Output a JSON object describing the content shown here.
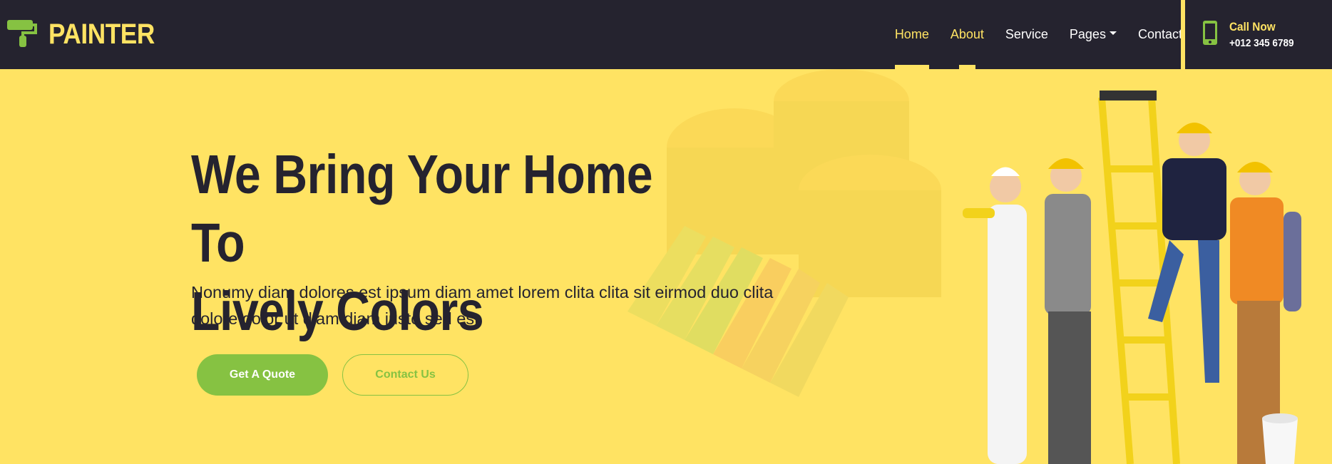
{
  "brand": {
    "name": "PAINTER",
    "logo_icon": "paint-roller-icon",
    "logo_color": "#86c242"
  },
  "nav": {
    "items": [
      {
        "label": "Home",
        "active": true
      },
      {
        "label": "About",
        "active": false
      },
      {
        "label": "Service",
        "active": false
      },
      {
        "label": "Pages",
        "active": false,
        "dropdown": true
      },
      {
        "label": "Contact",
        "active": false
      }
    ]
  },
  "call": {
    "icon": "mobile-phone-icon",
    "title": "Call Now",
    "number": "+012 345 6789"
  },
  "hero": {
    "title_line1": "We Bring Your Home To",
    "title_line2": "Lively Colors",
    "text": "Nonumy diam dolores est ipsum diam amet lorem clita clita sit eirmod duo clita dolore dolor ut diam diam justo sed est",
    "primary_button": "Get A Quote",
    "secondary_button": "Contact Us"
  },
  "colors": {
    "dark": "#25232f",
    "yellow": "#ffe363",
    "green": "#86c242"
  }
}
